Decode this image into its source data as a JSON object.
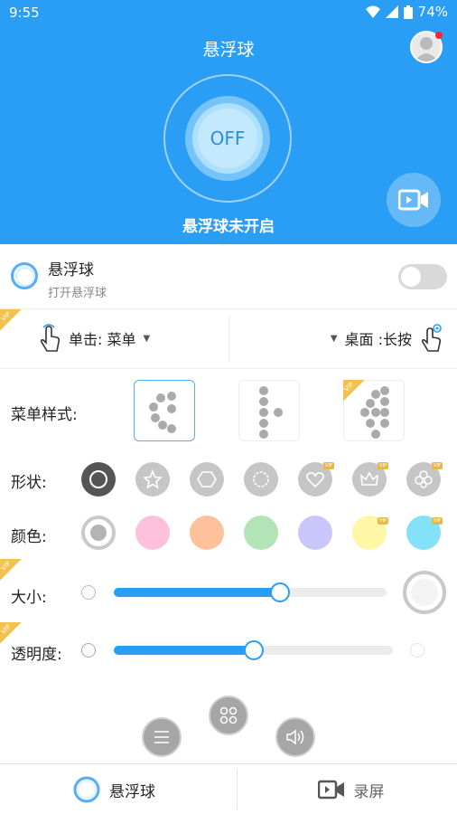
{
  "status_bar": {
    "time": "9:55",
    "battery": "74%"
  },
  "header": {
    "title": "悬浮球",
    "toggle_label": "OFF",
    "status": "悬浮球未开启"
  },
  "float_toggle": {
    "title": "悬浮球",
    "subtitle": "打开悬浮球"
  },
  "actions": {
    "single_click": "单击: 菜单",
    "long_press": "桌面 :长按"
  },
  "vip_tag": "VIP",
  "menu_style": {
    "label": "菜单样式:"
  },
  "shape": {
    "label": "形状:"
  },
  "color": {
    "label": "颜色:",
    "swatches": [
      "#ffc0dc",
      "#ffc09c",
      "#b2e4b8",
      "#c9c6fb",
      "#fff6a6",
      "#83e1f8"
    ]
  },
  "size": {
    "label": "大小:",
    "value_percent": 61
  },
  "opacity": {
    "label": "透明度:",
    "value_percent": 50
  },
  "bottom_nav": {
    "float_ball": "悬浮球",
    "record_screen": "录屏"
  },
  "accent_color": "#2a9df4"
}
